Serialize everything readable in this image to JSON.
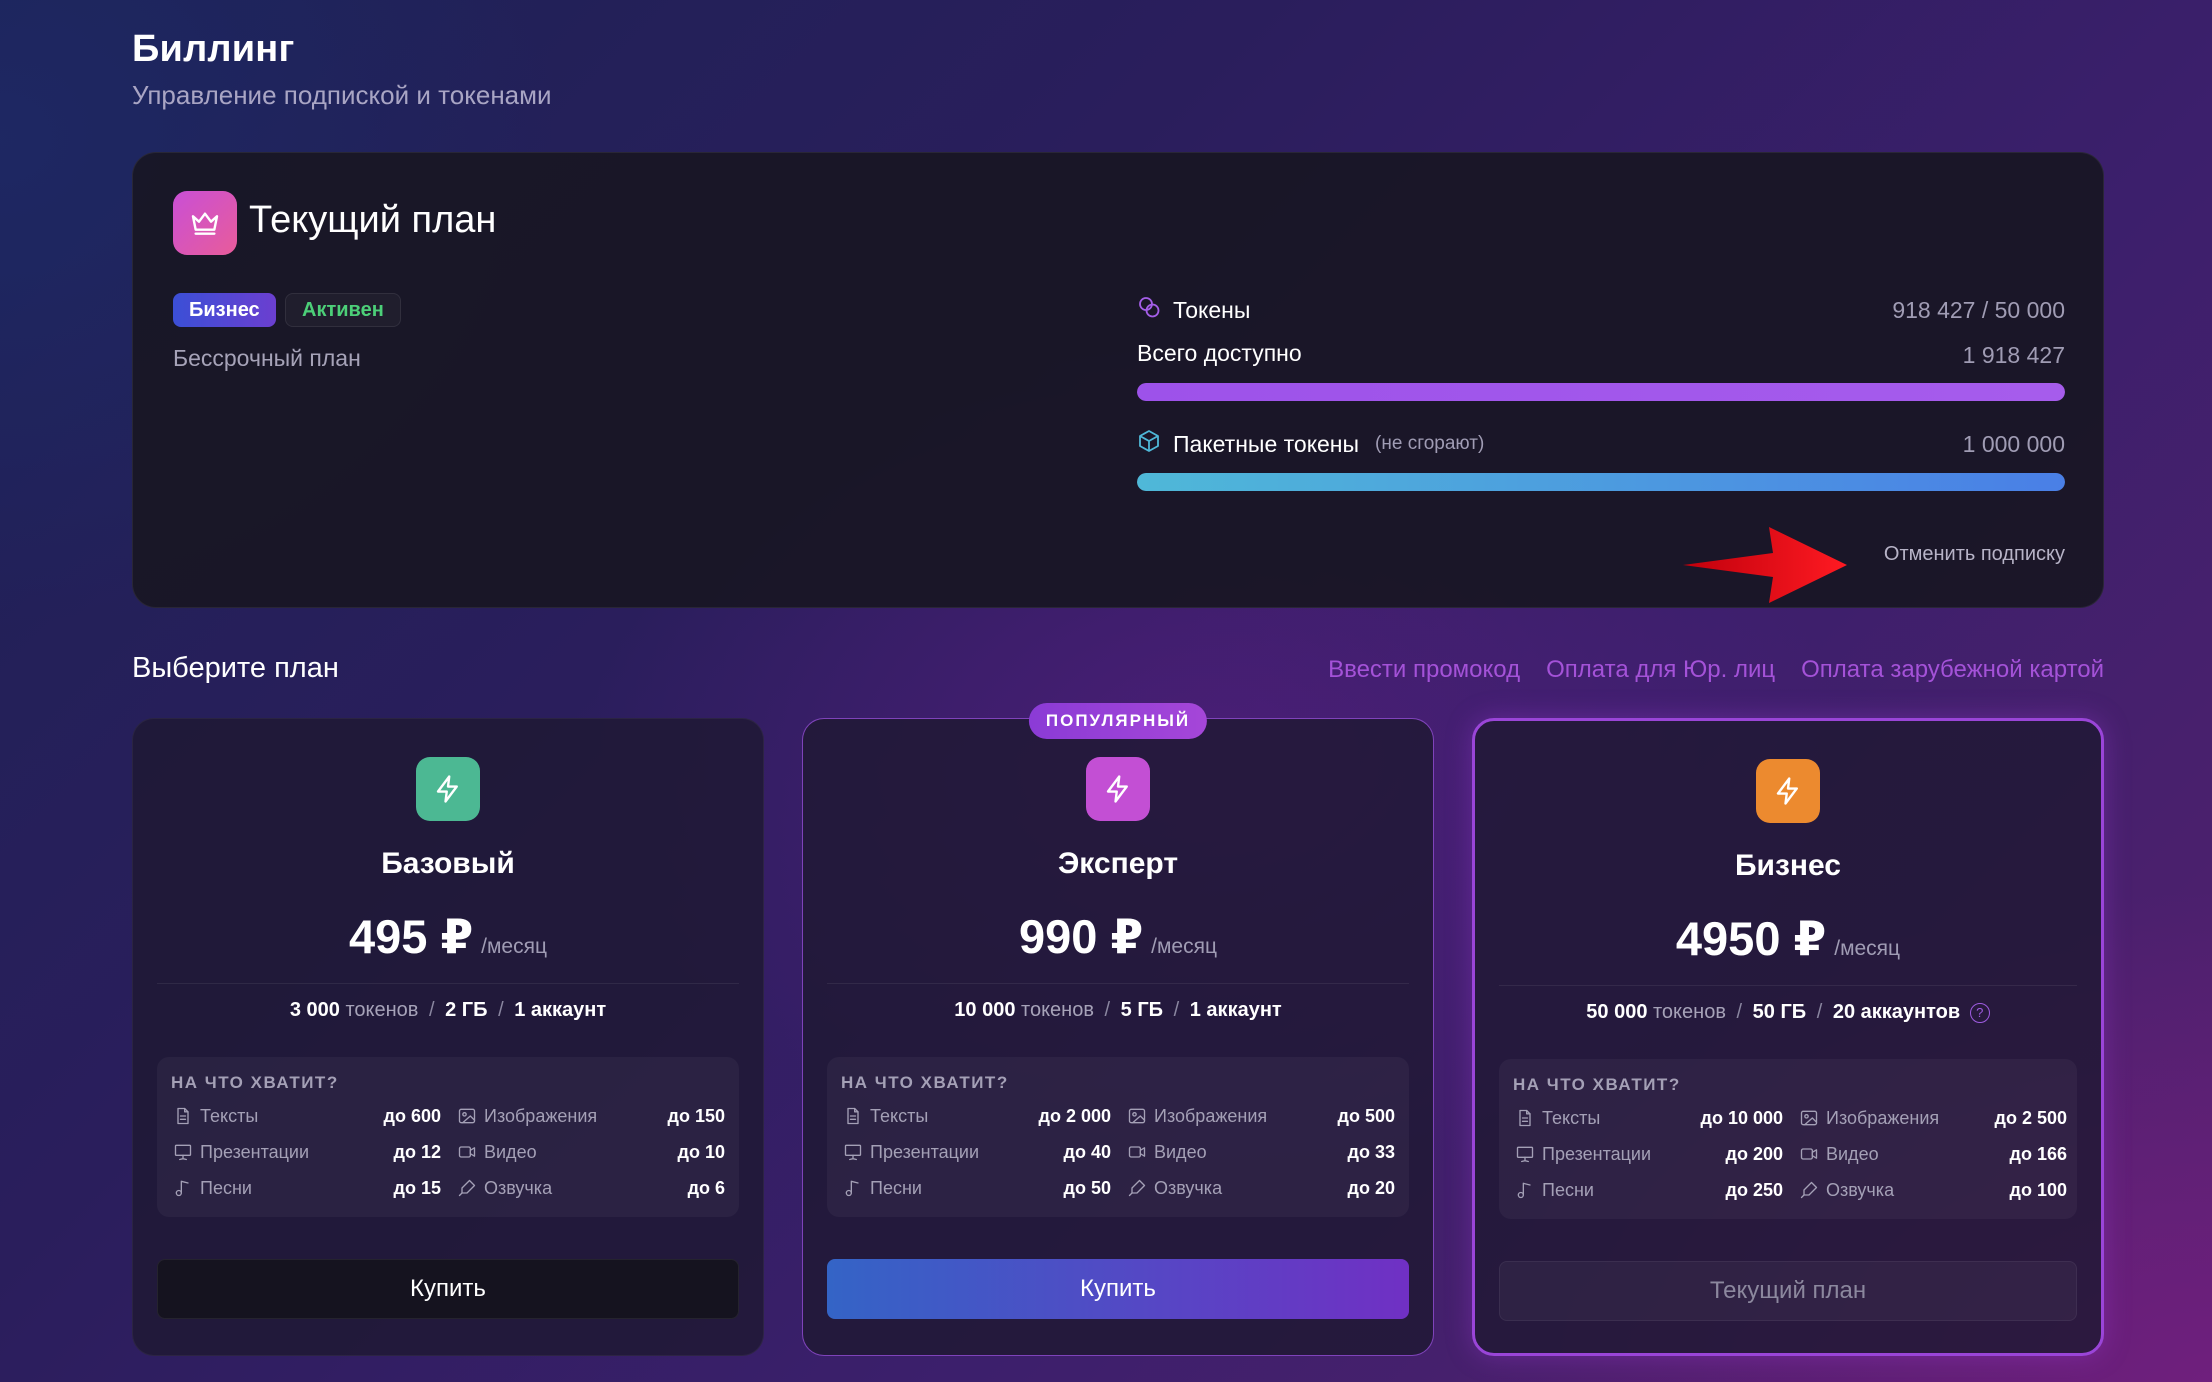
{
  "header": {
    "title": "Биллинг",
    "subtitle": "Управление подпиской и токенами"
  },
  "current_plan": {
    "title": "Текущий план",
    "icon": "crown-icon",
    "plan_badge": "Бизнес",
    "status_badge": "Активен",
    "term": "Бессрочный план",
    "tokens_label": "Токены",
    "tokens_value": "918 427 / 50 000",
    "total_label": "Всего доступно",
    "total_value": "1 918 427",
    "total_fill": 1.0,
    "package_label": "Пакетные токены",
    "package_note": "(не сгорают)",
    "package_value": "1 000 000",
    "package_fill": 1.0,
    "cancel_link": "Отменить подписку"
  },
  "choose": {
    "title": "Выберите план",
    "links": [
      "Ввести промокод",
      "Оплата для Юр. лиц",
      "Оплата зарубежной картой"
    ]
  },
  "plans": [
    {
      "name": "Базовый",
      "price": "495 ₽",
      "period": "/месяц",
      "icon_color": "#4cb893",
      "tokens": "3 000",
      "tokens_word": "токенов",
      "storage": "2 ГБ",
      "accounts": "1 аккаунт",
      "usage_title": "НА ЧТО ХВАТИТ?",
      "usage": [
        {
          "label": "Тексты",
          "value": "до 600",
          "icon": "document-icon"
        },
        {
          "label": "Изображения",
          "value": "до 150",
          "icon": "image-icon"
        },
        {
          "label": "Презентации",
          "value": "до 12",
          "icon": "presentation-icon"
        },
        {
          "label": "Видео",
          "value": "до 10",
          "icon": "video-icon"
        },
        {
          "label": "Песни",
          "value": "до 15",
          "icon": "music-icon"
        },
        {
          "label": "Озвучка",
          "value": "до 6",
          "icon": "voice-icon"
        }
      ],
      "button": "Купить"
    },
    {
      "name": "Эксперт",
      "price": "990 ₽",
      "period": "/месяц",
      "icon_color": "#c34fd4",
      "badge": "ПОПУЛЯРНЫЙ",
      "tokens": "10 000",
      "tokens_word": "токенов",
      "storage": "5 ГБ",
      "accounts": "1 аккаунт",
      "usage_title": "НА ЧТО ХВАТИТ?",
      "usage": [
        {
          "label": "Тексты",
          "value": "до 2 000",
          "icon": "document-icon"
        },
        {
          "label": "Изображения",
          "value": "до 500",
          "icon": "image-icon"
        },
        {
          "label": "Презентации",
          "value": "до 40",
          "icon": "presentation-icon"
        },
        {
          "label": "Видео",
          "value": "до 33",
          "icon": "video-icon"
        },
        {
          "label": "Песни",
          "value": "до 50",
          "icon": "music-icon"
        },
        {
          "label": "Озвучка",
          "value": "до 20",
          "icon": "voice-icon"
        }
      ],
      "button": "Купить"
    },
    {
      "name": "Бизнес",
      "price": "4950 ₽",
      "period": "/месяц",
      "icon_color": "#ec8a2f",
      "tokens": "50 000",
      "tokens_word": "токенов",
      "storage": "50 ГБ",
      "accounts": "20 аккаунтов",
      "usage_title": "НА ЧТО ХВАТИТ?",
      "usage": [
        {
          "label": "Тексты",
          "value": "до 10 000",
          "icon": "document-icon"
        },
        {
          "label": "Изображения",
          "value": "до 2 500",
          "icon": "image-icon"
        },
        {
          "label": "Презентации",
          "value": "до 200",
          "icon": "presentation-icon"
        },
        {
          "label": "Видео",
          "value": "до 166",
          "icon": "video-icon"
        },
        {
          "label": "Песни",
          "value": "до 250",
          "icon": "music-icon"
        },
        {
          "label": "Озвучка",
          "value": "до 100",
          "icon": "voice-icon"
        }
      ],
      "button": "Текущий план"
    }
  ],
  "colors": {
    "accent": "#a452d8",
    "active": "#4ccf78",
    "annotation_arrow": "#e0101a"
  }
}
